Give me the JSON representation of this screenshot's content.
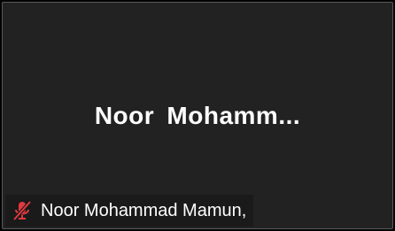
{
  "tile": {
    "display_name": "Noor  Mohamm...",
    "participant_name": "Noor Mohammad Mamun,",
    "mic_status_icon": "microphone-muted-icon"
  },
  "colors": {
    "tile_background": "#222222",
    "tile_border": "#5a5a5a",
    "text": "#ffffff",
    "muted_icon": "#e0393e"
  }
}
